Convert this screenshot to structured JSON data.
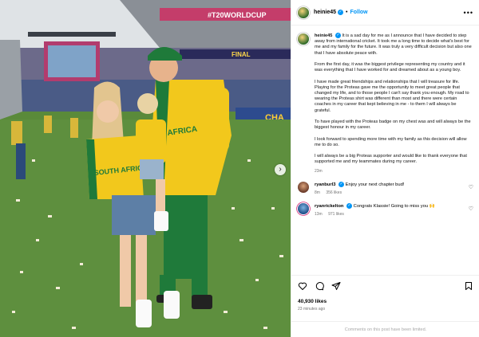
{
  "post": {
    "username": "heinie45",
    "follow_label": "Follow",
    "more_label": "•••",
    "carousel_next": "›"
  },
  "caption": {
    "username": "heinie45",
    "paragraphs": [
      "It is a sad day for me as I announce that I have decided to step away from international cricket. It took me a long time to decide what's best for me and my family for the future. It was truly a very difficult decision but also one that I have absolute peace with.",
      "From the first day, it was the biggest privilege representing my country and it was everything that I have worked for and dreamed about as a young boy.",
      "I have made great friendships and relationships that I will treasure for life. Playing for the Proteas gave me the opportunity to meet great people that changed my life, and to those people I can't say thank you enough. My road to wearing the Proteas shirt was different than most and there were certain coaches in my career that kept believing in me - to them I will always be grateful.",
      "To have played with the Proteas badge on my chest was and will always be the biggest honour in my career.",
      "I look forward to spending more time with my family as this decision will allow me to do so.",
      "I will always be a big Proteas supporter and would like to thank everyone that supported me and my teammates during my career."
    ],
    "time": "23m"
  },
  "comments": [
    {
      "username": "ryanburl3",
      "text": "Enjoy your next chapter bud!",
      "time": "8m",
      "likes": "356 likes"
    },
    {
      "username": "ryanrickelton",
      "text": "Congrats Klassie! Going to miss you 🙌",
      "time": "13m",
      "likes": "971 likes"
    }
  ],
  "likes_count": "40,930 likes",
  "posted_ago": "23 minutes ago",
  "comments_disabled": "Comments on this post have been limited.",
  "photo": {
    "banner_top": "#T20WORLDCUP",
    "banner_final": "FINAL",
    "banner_side": "CHA",
    "shirt_text": "SOUTH AFRICA"
  },
  "colors": {
    "accent": "#0095f6",
    "jersey_yellow": "#f2c81c",
    "jersey_green": "#1f7a3a",
    "grass": "#5e8f3e"
  },
  "icons": [
    "heart-icon",
    "comment-icon",
    "share-icon",
    "bookmark-icon",
    "more-icon",
    "verified-icon"
  ]
}
